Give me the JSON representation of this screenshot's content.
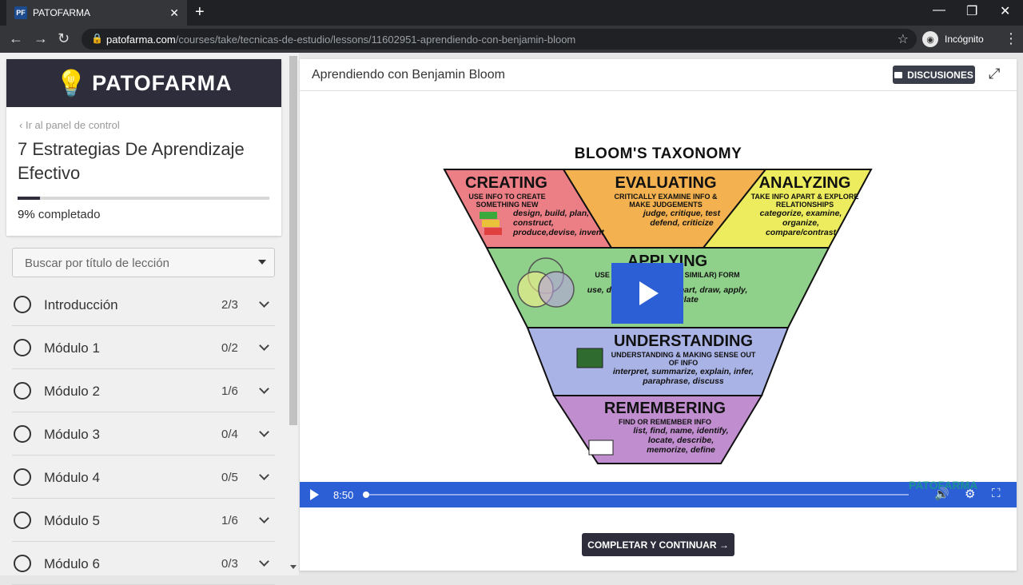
{
  "browser": {
    "tab_title": "PATOFARMA",
    "favicon_text": "PF",
    "url_domain": "patofarma.com",
    "url_path": "/courses/take/tecnicas-de-estudio/lessons/11602951-aprendiendo-con-benjamin-bloom",
    "incognito_label": "Incógnito"
  },
  "sidebar": {
    "brand": "PATOFARMA",
    "back_link": "Ir al panel de control",
    "course_title": "7 Estrategias De Aprendizaje Efectivo",
    "progress_percent": 9,
    "progress_value": "9%",
    "progress_label": "completado",
    "search_placeholder": "Buscar por título de lección",
    "modules": [
      {
        "name": "Introducción",
        "count": "2/3"
      },
      {
        "name": "Módulo 1",
        "count": "0/2"
      },
      {
        "name": "Módulo 2",
        "count": "1/6"
      },
      {
        "name": "Módulo 3",
        "count": "0/4"
      },
      {
        "name": "Módulo 4",
        "count": "0/5"
      },
      {
        "name": "Módulo 5",
        "count": "1/6"
      },
      {
        "name": "Módulo 6",
        "count": "0/3"
      }
    ]
  },
  "lesson": {
    "title": "Aprendiendo con Benjamin Bloom",
    "discussions_label": "DISCUSIONES",
    "complete_label": "COMPLETAR Y CONTINUAR →"
  },
  "video": {
    "time": "8:50",
    "played_fraction": 0.0,
    "watermark": "PATOFARMA",
    "bloom": {
      "title": "BLOOM'S TAXONOMY",
      "creating": {
        "title": "CREATING",
        "sub": "USE INFO TO CREATE SOMETHING NEW",
        "verbs": "design, build, plan, construct, produce,devise, invent"
      },
      "evaluating": {
        "title": "EVALUATING",
        "sub": "CRITICALLY EXAMINE INFO & MAKE JUDGEMENTS",
        "verbs": "judge, critique, test defend, criticize"
      },
      "analyzing": {
        "title": "ANALYZING",
        "sub": "TAKE INFO APART & EXPLORE RELATIONSHIPS",
        "verbs": "categorize, examine, organize, compare/contrast"
      },
      "applying": {
        "title": "APPLYING",
        "sub": "USE INFO IN A NEW (BUT SIMILAR) FORM",
        "verbs": "use, diagram, make a chart, draw, apply, solve, calculate"
      },
      "understanding": {
        "title": "UNDERSTANDING",
        "sub": "UNDERSTANDING & MAKING SENSE OUT OF INFO",
        "verbs": "interpret, summarize, explain, infer, paraphrase, discuss"
      },
      "remembering": {
        "title": "REMEMBERING",
        "sub": "FIND OR REMEMBER INFO",
        "verbs": "list, find, name, identify, locate, describe, memorize, define"
      }
    }
  },
  "colors": {
    "brand_dark": "#2d2d3c",
    "video_blue": "#2c5fd6",
    "creating": "#ec7f86",
    "evaluating": "#f3b14f",
    "analyzing": "#ecec5e",
    "applying": "#8fd18a",
    "understanding": "#aab3e6",
    "remembering": "#c08dcf"
  }
}
